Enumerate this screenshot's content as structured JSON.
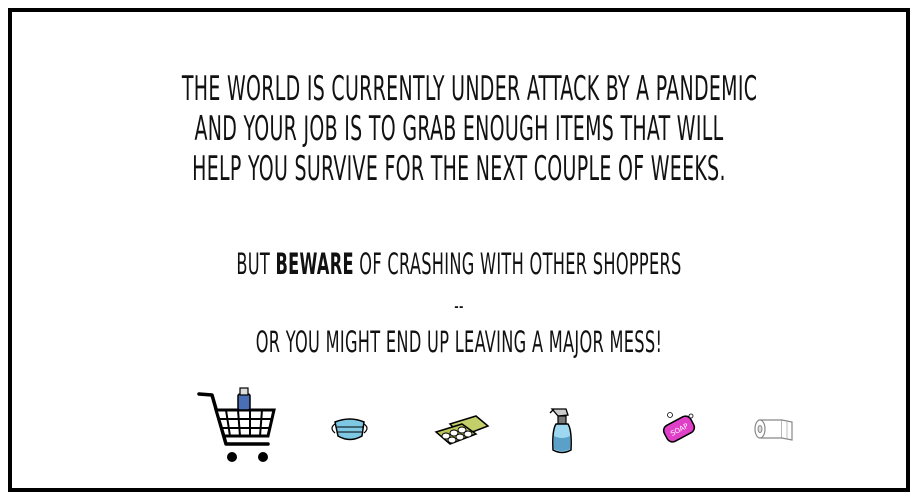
{
  "intro": {
    "line1": "THE WORLD IS CURRENTLY UNDER ATTACK BY A PANDEMIC",
    "line2": "AND YOUR JOB IS TO GRAB ENOUGH ITEMS THAT WILL",
    "line3": "HELP YOU SURVIVE FOR THE NEXT COUPLE OF WEEKS."
  },
  "warning": {
    "prefix": "BUT ",
    "emphasis": "BEWARE",
    "suffix": " OF CRASHING WITH OTHER SHOPPERS",
    "separator": "--",
    "line2": "OR YOU MIGHT END UP LEAVING A MAJOR MESS!"
  },
  "items": [
    {
      "icon": "shopping-cart-icon"
    },
    {
      "icon": "face-mask-icon"
    },
    {
      "icon": "egg-carton-icon"
    },
    {
      "icon": "spray-bottle-icon"
    },
    {
      "icon": "soap-icon",
      "label": "SOAP"
    },
    {
      "icon": "toilet-paper-icon"
    }
  ],
  "colors": {
    "border": "#000000",
    "text": "#111111",
    "mask": "#7ec8e3",
    "carton": "#c5cf6a",
    "soap": "#e040c8",
    "bottle": "#5aa0c8"
  }
}
